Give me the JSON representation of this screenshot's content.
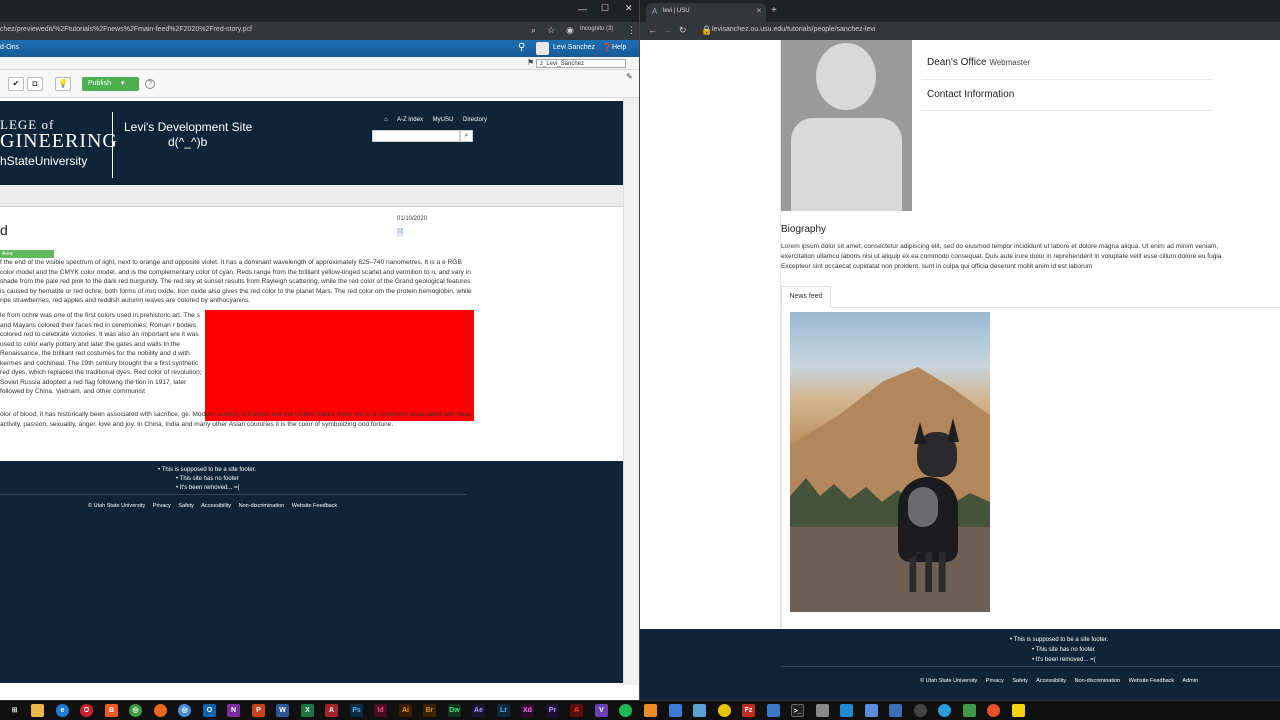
{
  "left_window": {
    "url": "chez/previewedit/%2Ftutorials%2Fnews%2Fmain-feed%2F2020%2Fred-story.pcf",
    "incognito": "Incognito (3)",
    "ou": {
      "addons_label": "d-Ons",
      "user_name": "Levi Sanchez",
      "help_label": "Help",
      "user_select": "z_Levi_Sanchez",
      "publish_label": "Publish",
      "help_icon": "?"
    },
    "site": {
      "college_line": "LEGE of",
      "engineering_line": "GINEERING",
      "university_line": "hStateUniversity",
      "site_title": "Levi's Development Site",
      "site_subtitle": "d(^_^)b",
      "top_links": [
        "A-Z Index",
        "MyUSU",
        "Directory"
      ],
      "page_heading_fragment": "d",
      "date": "01/10/2020",
      "green_tag": "Area",
      "para1": "f the end of the visible spectrum of light, next to orange and opposite violet. It has a dominant wavelength of approximately 625–740 nanometres. It is a e RGB color model and the CMYK color model, and is the complementary color of cyan. Reds range from the brilliant yellow-tinged scarlet and vermilion to n, and vary in shade from the pale red pink to the dark red burgundy. The red sky at sunset results from Rayleigh scattering, while the red color of the Grand geological features is caused by hematite or red ochre, both forms of iron oxide. Iron oxide also gives the red color to the planet Mars. The red color om the protein hemoglobin, while ripe strawberries, red apples and reddish autumn leaves are colored by anthocyanins.",
      "para2": "le from ochre was one of the first colors used in prehistoric art. The s and Mayans colored their faces red in ceremonies; Roman r bodies colored red to celebrate victories. It was also an important ere it was used to color early pottery and later the gates and walls In the Renaissance, the brilliant red costumes for the nobility and d with kermes and cochineal. The 19th century brought the e first synthetic red dyes, which replaced the traditional dyes. Red color of revolution; Soviet Russia adopted a red flag following the tion in 1917, later followed by China, Vietnam, and other communist",
      "para3": "olor of blood, it has historically been associated with sacrifice, ge. Modern surveys in Europe and the United States show red is st commonly associated with heat, activity, passion, sexuality, anger, love and joy. In China, India and many other Asian countries it is the color of symbolizing ood fortune.",
      "footer_items": [
        "This is supposed to be a site footer.",
        "This site has no footer",
        "It's been removed... =("
      ],
      "footer_links": [
        "© Utah State University",
        "Privacy",
        "Safety",
        "Accessibility",
        "Non-discrimination",
        "Website Feedback"
      ]
    }
  },
  "right_window": {
    "tab_title": "levi | USU",
    "url": "levisanchez.ou.usu.edu/tutorials/people/sanchez-levi",
    "dept": "Dean's Office",
    "role": "Webmaster",
    "contact": "Contact Information",
    "bio_heading": "Biography",
    "bio_lines": [
      "Lorem ipsum dolor sit amet, consectetur adipiscing elit, sed do eiusmod tempor incididunt ut labore et dolore magna aliqua. Ut enim ad minim veniam,",
      "exercitation ullamco laboris nisi ut aliquip ex ea commodo consequat. Duis aute irure dolor in reprehenderit in voluptate velit esse cillum dolore eu fugia",
      "Excepteur sint occaecat cupidatat non proident, sunt in culpa qui officia deserunt mollit anim id est laborum"
    ],
    "news_tab": "News feed",
    "footer_items": [
      "This is supposed to be a site footer.",
      "This site has no footer",
      "It's been removed... =("
    ],
    "footer_links": [
      "© Utah State University",
      "Privacy",
      "Safety",
      "Accessibility",
      "Non-discrimination",
      "Website Feedback",
      "Admin"
    ]
  },
  "colors": {
    "usu_navy": "#0f2439",
    "ou_blue": "#1e6fb3",
    "publish_green": "#4caf50",
    "link_blue": "#3a6fb5",
    "red_block": "#ff0000"
  }
}
